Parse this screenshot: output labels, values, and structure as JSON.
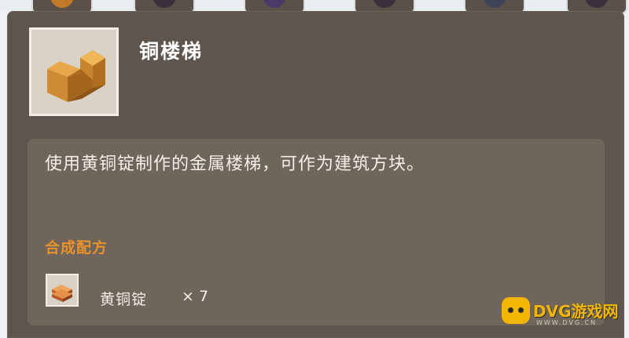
{
  "item": {
    "name": "铜楼梯",
    "icon": "copper-stairs-icon",
    "description": "使用黄铜锭制作的金属楼梯，可作为建筑方块。"
  },
  "recipe": {
    "title": "合成配方",
    "ingredients": [
      {
        "icon": "brass-ingot-icon",
        "name": "黄铜锭",
        "count": "× 7"
      }
    ]
  },
  "watermark": {
    "text": "DVG游戏网",
    "sub": "WWW.DVG.CN"
  },
  "colors": {
    "panel": "#5e564e",
    "desc_box": "#6f655b",
    "recipe_title": "#e8922c",
    "watermark": "#f2b705"
  }
}
